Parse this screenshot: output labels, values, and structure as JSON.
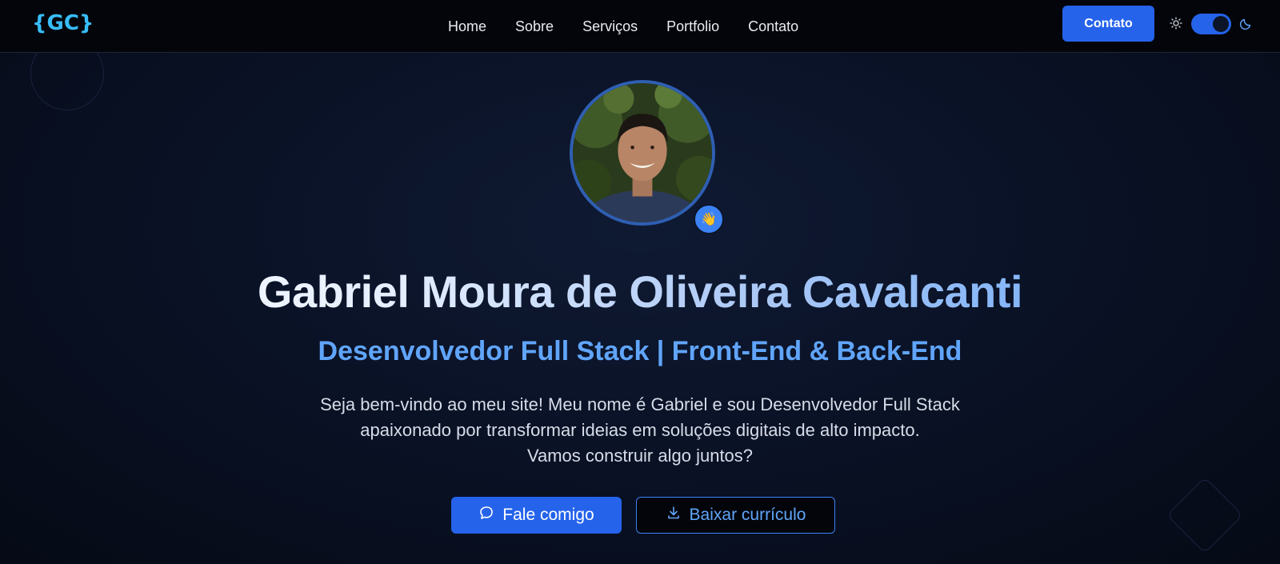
{
  "logo": {
    "text": "{GC}"
  },
  "nav": {
    "links": [
      {
        "label": "Home"
      },
      {
        "label": "Sobre"
      },
      {
        "label": "Serviços"
      },
      {
        "label": "Portfolio"
      },
      {
        "label": "Contato"
      }
    ],
    "contact_button": "Contato",
    "theme_toggle": {
      "mode": "dark",
      "on": true
    }
  },
  "hero": {
    "avatar_badge_icon": "👋",
    "name": "Gabriel Moura de Oliveira Cavalcanti",
    "subtitle": "Desenvolvedor Full Stack | Front-End & Back-End",
    "description_lines": [
      "Seja bem-vindo ao meu site! Meu nome é Gabriel e sou Desenvolvedor Full Stack",
      "apaixonado por transformar ideias em soluções digitais de alto impacto.",
      "Vamos construir algo juntos?"
    ],
    "primary_button": "Fale comigo",
    "secondary_button": "Baixar currículo"
  },
  "colors": {
    "accent": "#2563eb",
    "logo": "#38bdf8",
    "subtitle": "#60a5fa",
    "background": "#0a1226"
  },
  "icons": {
    "theme_light": "sun-icon",
    "theme_dark": "moon-icon",
    "chat": "chat-bubble-icon",
    "download": "download-icon"
  }
}
